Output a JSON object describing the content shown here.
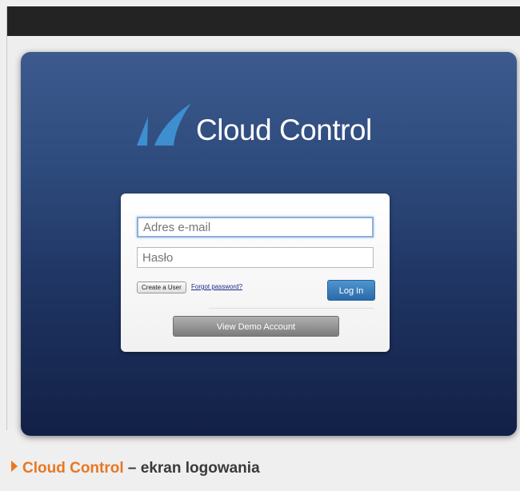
{
  "logo": {
    "text": "Cloud Control"
  },
  "login": {
    "email_placeholder": "Adres e-mail",
    "password_placeholder": "Hasło",
    "create_user_label": "Create a User",
    "forgot_password_label": "Forgot password?",
    "login_label": "Log In",
    "demo_label": "View Demo Account"
  },
  "caption": {
    "title": "Cloud Control",
    "subtitle": " – ekran logowania"
  },
  "colors": {
    "brand_blue": "#3e8fd0",
    "caption_orange": "#e87722",
    "login_button": "#3a80bd"
  }
}
